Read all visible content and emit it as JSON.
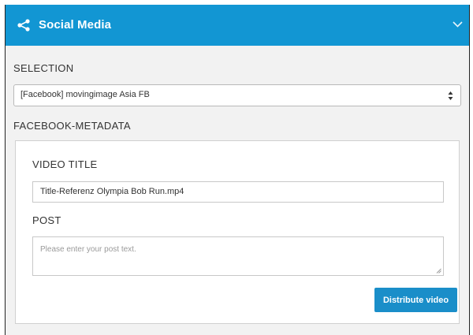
{
  "panel": {
    "title": "Social Media",
    "header_color": "#1296d3",
    "header_icon": "share-icon",
    "collapse_icon": "chevron-down-icon"
  },
  "selection": {
    "label": "SELECTION",
    "value": "[Facebook] movingimage Asia FB"
  },
  "metadata": {
    "label": "FACEBOOK-METADATA",
    "video_title_label": "VIDEO TITLE",
    "video_title_value": "Title-Referenz Olympia Bob Run.mp4",
    "post_label": "POST",
    "post_placeholder": "Please enter your post text.",
    "post_value": ""
  },
  "actions": {
    "distribute_label": "Distribute video",
    "distribute_color": "#1a8ec9"
  }
}
